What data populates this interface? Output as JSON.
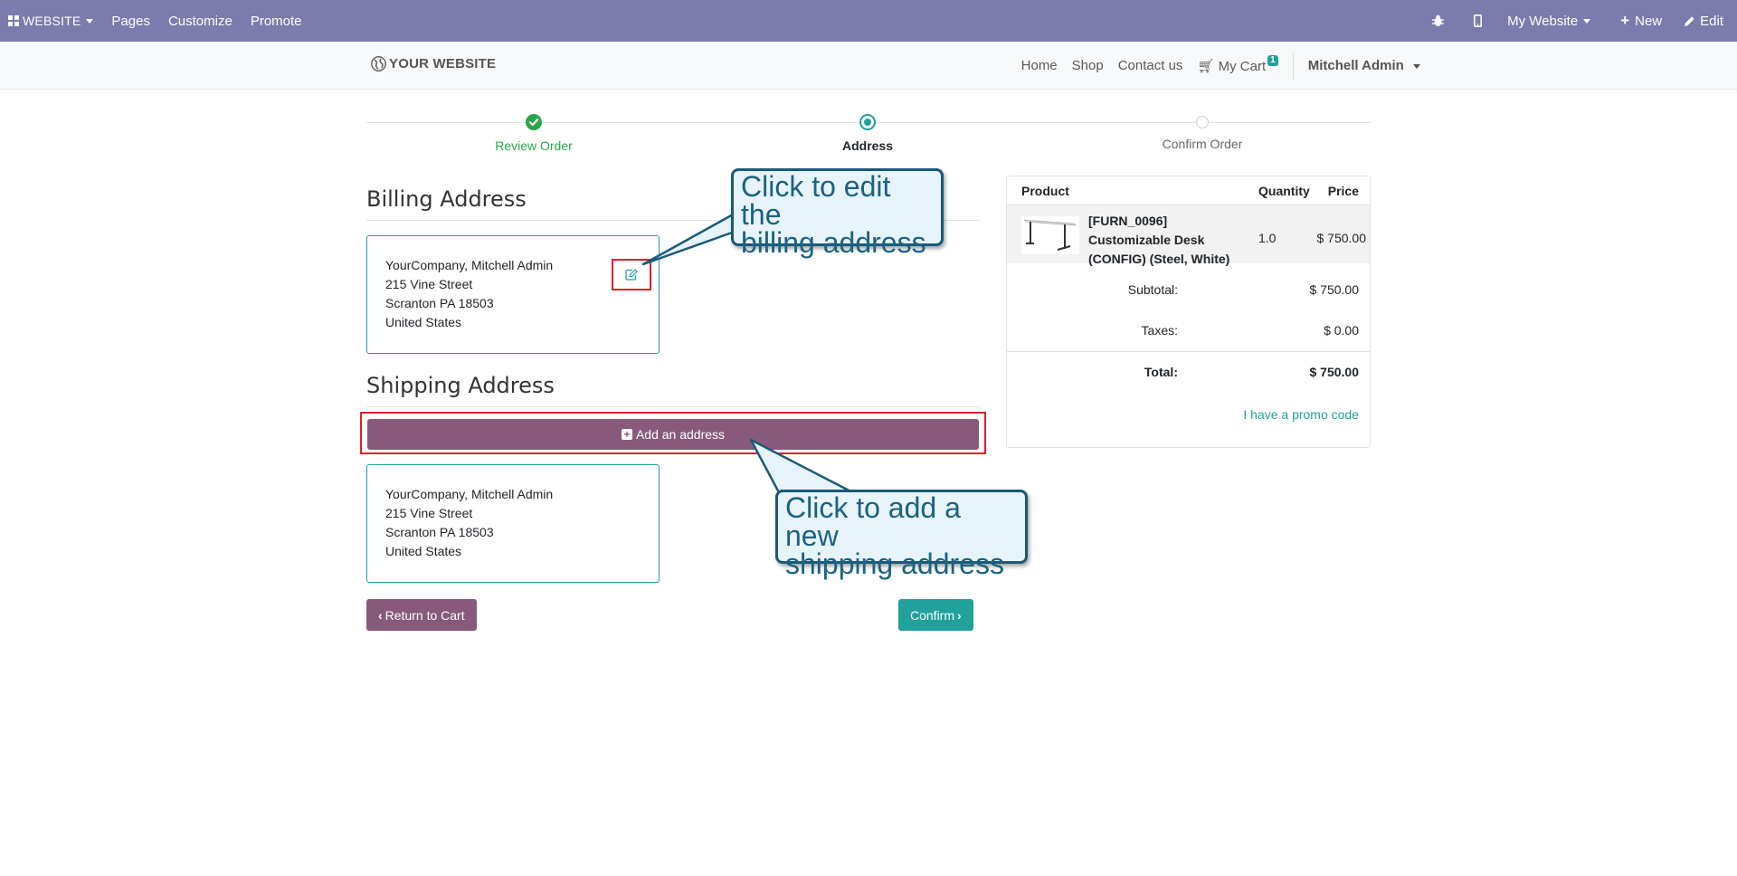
{
  "topbar": {
    "app_label": "WEBSITE",
    "menu": [
      "Pages",
      "Customize",
      "Promote"
    ],
    "website_selector": "My Website",
    "new_label": "New",
    "edit_label": "Edit"
  },
  "site": {
    "logo_text": "YOUR WEBSITE",
    "nav": [
      "Home",
      "Shop",
      "Contact us"
    ],
    "cart_label": "My Cart",
    "cart_count": "1",
    "user": "Mitchell Admin"
  },
  "wizard": {
    "steps": [
      {
        "label": "Review Order",
        "state": "done"
      },
      {
        "label": "Address",
        "state": "current"
      },
      {
        "label": "Confirm Order",
        "state": "todo"
      }
    ]
  },
  "billing": {
    "title": "Billing Address",
    "lines": [
      "YourCompany, Mitchell Admin",
      "215 Vine Street",
      "Scranton PA 18503",
      "United States"
    ]
  },
  "shipping": {
    "title": "Shipping Address",
    "add_label": "Add an address",
    "lines": [
      "YourCompany, Mitchell Admin",
      "215 Vine Street",
      "Scranton PA 18503",
      "United States"
    ]
  },
  "actions": {
    "return_label": "Return to Cart",
    "confirm_label": "Confirm"
  },
  "summary": {
    "headers": {
      "product": "Product",
      "quantity": "Quantity",
      "price": "Price"
    },
    "product": {
      "name": "[FURN_0096] Customizable Desk (CONFIG) (Steel, White)",
      "quantity": "1.0",
      "price": "$ 750.00"
    },
    "subtotal_label": "Subtotal:",
    "subtotal": "$ 750.00",
    "taxes_label": "Taxes:",
    "taxes": "$ 0.00",
    "total_label": "Total:",
    "total": "$ 750.00",
    "promo": "I have a promo code"
  },
  "callouts": {
    "edit_billing": [
      "Click to edit the",
      "billing address"
    ],
    "add_shipping": [
      "Click to add a new",
      "shipping address"
    ]
  },
  "colors": {
    "admin_bar": "#7c7bad",
    "primary": "#875a7b",
    "accent": "#21a19b",
    "highlight_box": "#e21d2b"
  }
}
